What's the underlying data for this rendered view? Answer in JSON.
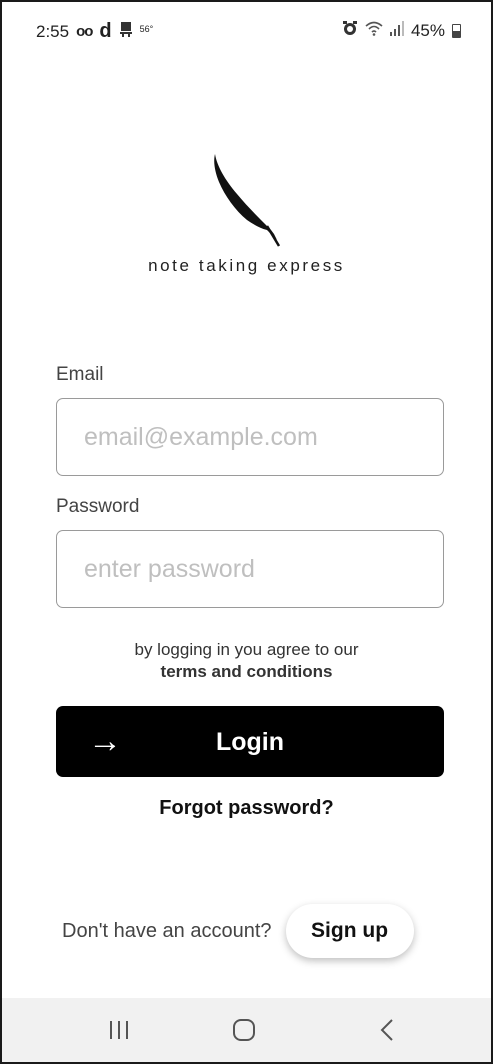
{
  "status_bar": {
    "time": "2:55",
    "voicemail_icon": "voicemail-icon",
    "d_icon": "d",
    "temperature": "56°",
    "battery_percent": "45%",
    "icons": [
      "voicemail-icon",
      "d-app-icon",
      "weather-icon",
      "alarm-icon",
      "wifi-icon",
      "signal-icon",
      "battery-icon"
    ]
  },
  "logo": {
    "icon": "feather-quill-icon",
    "text": "note taking express"
  },
  "form": {
    "email_label": "Email",
    "email_placeholder": "email@example.com",
    "email_value": "",
    "password_label": "Password",
    "password_placeholder": "enter password",
    "password_value": ""
  },
  "terms": {
    "prefix": "by logging in you agree to our",
    "link": "terms and conditions"
  },
  "login_button": {
    "icon": "arrow-right-icon",
    "arrow": "→",
    "label": "Login"
  },
  "forgot_password": "Forgot password?",
  "signup": {
    "prompt": "Don't have an account?",
    "button": "Sign up"
  },
  "nav_bar": {
    "recent": "recent-apps-icon",
    "home": "home-icon",
    "back": "back-icon"
  },
  "colors": {
    "primary_button": "#000000",
    "background": "#ffffff",
    "nav_bar": "#f1f1f1",
    "input_border": "#9a9a9a",
    "placeholder": "#bfbfbf"
  }
}
